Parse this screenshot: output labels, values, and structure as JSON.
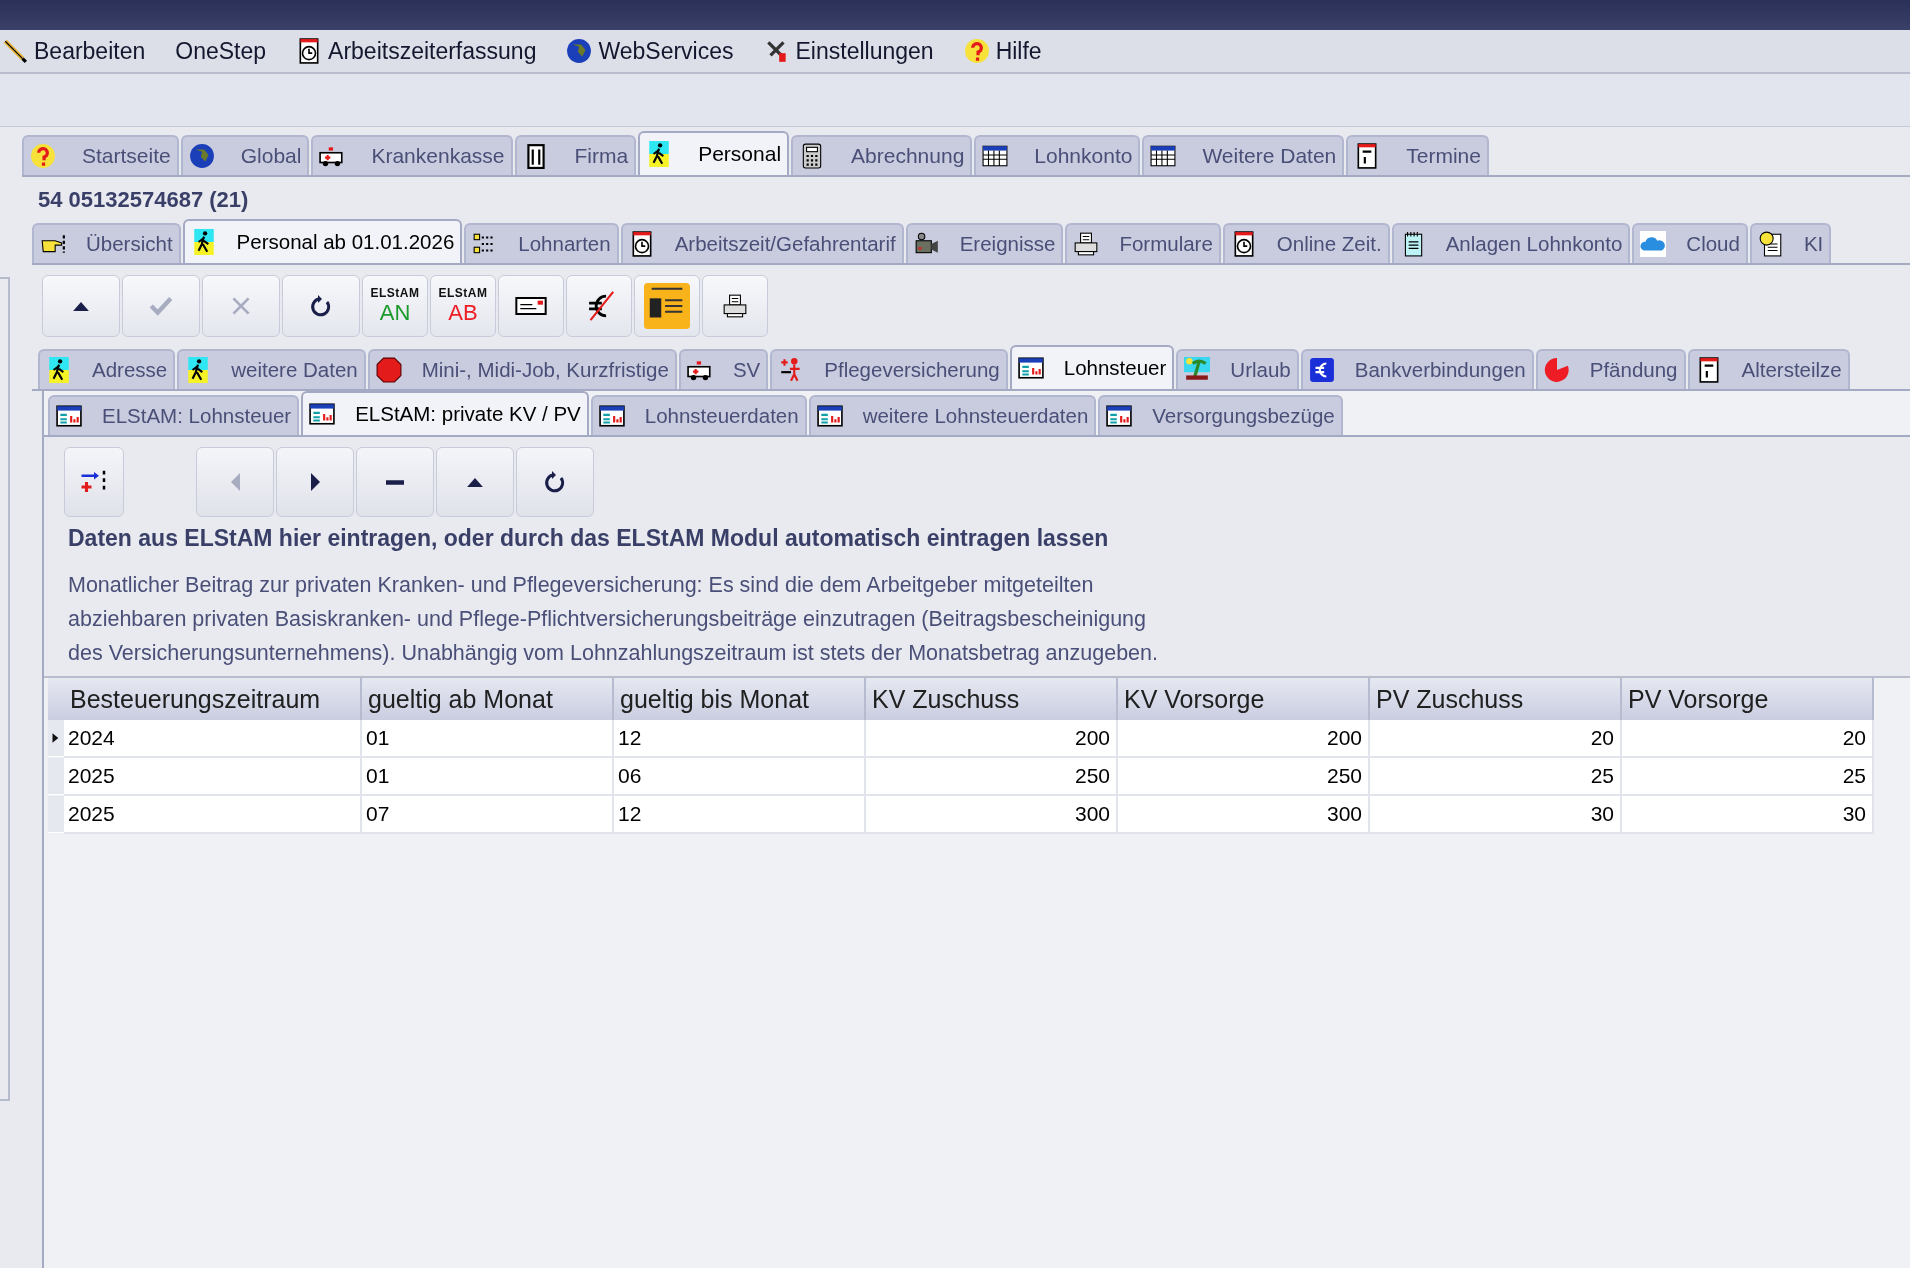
{
  "menu": [
    {
      "label": "Bearbeiten"
    },
    {
      "label": "OneStep"
    },
    {
      "label": "Arbeitszeiterfassung"
    },
    {
      "label": "WebServices"
    },
    {
      "label": "Einstellungen"
    },
    {
      "label": "Hilfe"
    }
  ],
  "main_tabs": [
    {
      "label": "Startseite",
      "selected": false
    },
    {
      "label": "Global",
      "selected": false
    },
    {
      "label": "Krankenkasse",
      "selected": false
    },
    {
      "label": "Firma",
      "selected": false
    },
    {
      "label": "Personal",
      "selected": true
    },
    {
      "label": "Abrechnung",
      "selected": false
    },
    {
      "label": "Lohnkonto",
      "selected": false
    },
    {
      "label": "Weitere Daten",
      "selected": false
    },
    {
      "label": "Termine",
      "selected": false
    }
  ],
  "record_title": "54 05132574687 (21)",
  "sub_tabs": [
    {
      "label": "Übersicht",
      "selected": false
    },
    {
      "label": "Personal ab 01.01.2026",
      "selected": true
    },
    {
      "label": "Lohnarten",
      "selected": false
    },
    {
      "label": "Arbeitszeit/Gefahrentarif",
      "selected": false
    },
    {
      "label": "Ereignisse",
      "selected": false
    },
    {
      "label": "Formulare",
      "selected": false
    },
    {
      "label": "Online Zeit.",
      "selected": false
    },
    {
      "label": "Anlagen Lohnkonto",
      "selected": false
    },
    {
      "label": "Cloud",
      "selected": false
    },
    {
      "label": "KI",
      "selected": false
    }
  ],
  "toolbar": [
    {
      "kind": "up",
      "disabled": false
    },
    {
      "kind": "check",
      "disabled": true
    },
    {
      "kind": "cancel",
      "disabled": true
    },
    {
      "kind": "refresh",
      "disabled": false
    },
    {
      "kind": "elstam",
      "caption": "ELStAM",
      "label": "AN",
      "color": "#1a9a2a"
    },
    {
      "kind": "elstam",
      "caption": "ELStAM",
      "label": "AB",
      "color": "#ee1c24"
    },
    {
      "kind": "card"
    },
    {
      "kind": "euro"
    },
    {
      "kind": "idcard"
    },
    {
      "kind": "print"
    }
  ],
  "detail_tabs": [
    {
      "label": "Adresse",
      "selected": false
    },
    {
      "label": "weitere Daten",
      "selected": false
    },
    {
      "label": "Mini-, Midi-Job, Kurzfristige",
      "selected": false
    },
    {
      "label": "SV",
      "selected": false
    },
    {
      "label": "Pflegeversicherung",
      "selected": false
    },
    {
      "label": "Lohnsteuer",
      "selected": true
    },
    {
      "label": "Urlaub",
      "selected": false
    },
    {
      "label": "Bankverbindungen",
      "selected": false
    },
    {
      "label": "Pfändung",
      "selected": false
    },
    {
      "label": "Altersteilze",
      "selected": false
    }
  ],
  "lohnsteuer_tabs": [
    {
      "label": "ELStAM: Lohnsteuer",
      "selected": false
    },
    {
      "label": "ELStAM: private KV / PV",
      "selected": true
    },
    {
      "label": "Lohnsteuerdaten",
      "selected": false
    },
    {
      "label": "weitere Lohnsteuerdaten",
      "selected": false
    },
    {
      "label": "Versorgungsbezüge",
      "selected": false
    }
  ],
  "nav_buttons": [
    {
      "kind": "add"
    },
    {
      "kind": "prev",
      "disabled": true
    },
    {
      "kind": "next",
      "disabled": false
    },
    {
      "kind": "delete",
      "disabled": false
    },
    {
      "kind": "up",
      "disabled": false
    },
    {
      "kind": "refresh",
      "disabled": false
    }
  ],
  "heading": "Daten aus ELStAM hier eintragen, oder durch das ELStAM Modul automatisch eintragen lassen",
  "description": "Monatlicher Beitrag zur privaten Kranken- und Pflegeversicherung: Es sind die dem Arbeitgeber mitgeteilten abziehbaren privaten Basiskranken- und Pflege-Pflichtversicherungsbeiträge einzutragen (Beitragsbescheinigung des Versicherungsunternehmens). Unabhängig vom Lohnzahlungszeitraum ist stets der Monatsbetrag anzugeben.",
  "table": {
    "columns": [
      "Besteuerungszeitraum",
      "gueltig ab Monat",
      "gueltig bis Monat",
      "KV Zuschuss",
      "KV Vorsorge",
      "PV Zuschuss",
      "PV Vorsorge"
    ],
    "rows": [
      {
        "selected": true,
        "cells": [
          "2024",
          "01",
          "12",
          "200",
          "200",
          "20",
          "20"
        ]
      },
      {
        "selected": false,
        "cells": [
          "2025",
          "01",
          "06",
          "250",
          "250",
          "25",
          "25"
        ]
      },
      {
        "selected": false,
        "cells": [
          "2025",
          "07",
          "12",
          "300",
          "300",
          "30",
          "30"
        ]
      }
    ]
  }
}
